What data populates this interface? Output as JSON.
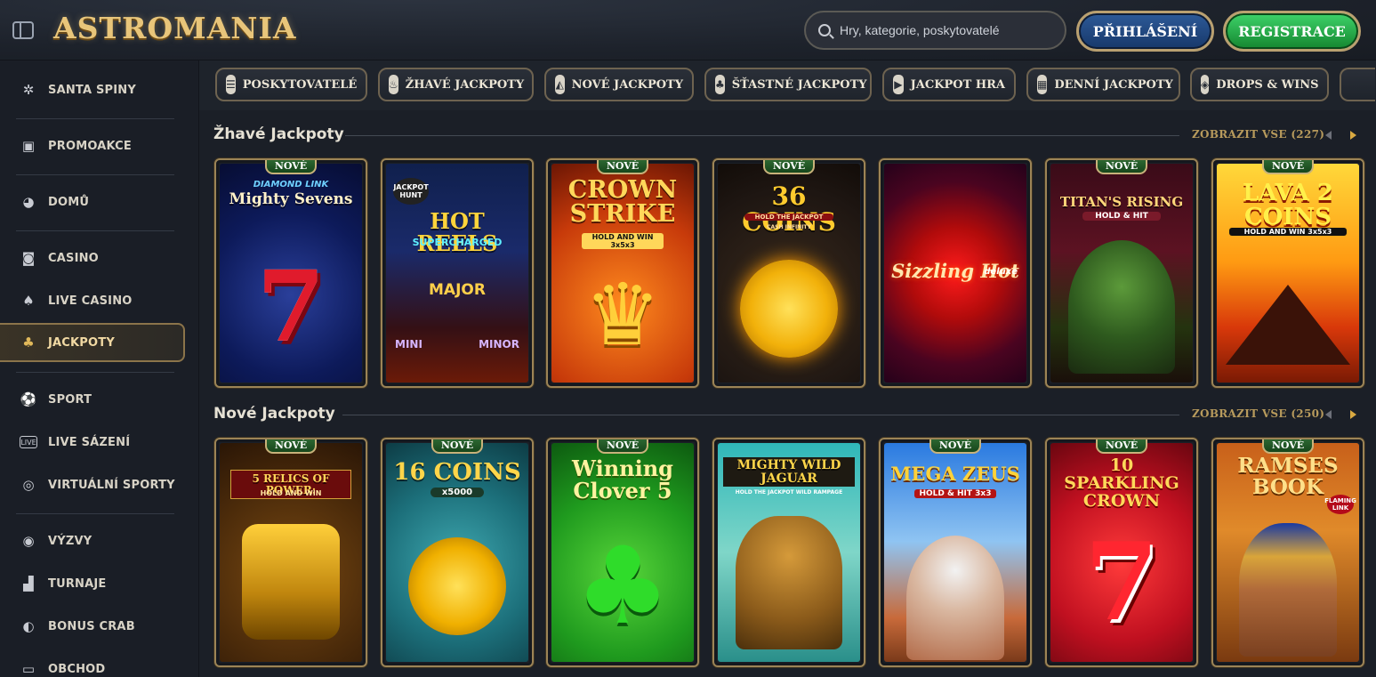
{
  "header": {
    "logo_text": "ASTROMANIA",
    "search_placeholder": "Hry, kategorie, poskytovatelé",
    "login_label": "PŘIHLÁŠENÍ",
    "register_label": "REGISTRACE",
    "icons": [
      "sidebar-toggle-icon",
      "search-icon"
    ]
  },
  "sidebar": {
    "items": [
      {
        "label": "SANTA SPINY",
        "icon": "santa-icon"
      },
      {
        "label": "PROMOAKCE",
        "icon": "gift-icon"
      },
      {
        "label": "DOMŮ",
        "icon": "home-icon"
      },
      {
        "label": "CASINO",
        "icon": "slot-machine-icon"
      },
      {
        "label": "LIVE CASINO",
        "icon": "cards-icon"
      },
      {
        "label": "JACKPOTY",
        "icon": "clover-icon",
        "active": true
      },
      {
        "label": "SPORT",
        "icon": "football-icon"
      },
      {
        "label": "LIVE SÁZENÍ",
        "icon": "live-icon"
      },
      {
        "label": "VIRTUÁLNÍ SPORTY",
        "icon": "virtual-sports-icon"
      },
      {
        "label": "VÝZVY",
        "icon": "target-icon"
      },
      {
        "label": "TURNAJE",
        "icon": "podium-icon"
      },
      {
        "label": "BONUS CRAB",
        "icon": "claw-icon"
      },
      {
        "label": "OBCHOD",
        "icon": "shop-icon"
      }
    ]
  },
  "categories": [
    {
      "label": "POSKYTOVATELÉ",
      "icon": "providers-icon"
    },
    {
      "label": "ŽHAVÉ JACKPOTY",
      "icon": "fire-icon"
    },
    {
      "label": "NOVÉ JACKPOTY",
      "icon": "bell-icon"
    },
    {
      "label": "ŠŤASTNÉ JACKPOTY",
      "icon": "clover-icon"
    },
    {
      "label": "JACKPOT HRA",
      "icon": "play-icon"
    },
    {
      "label": "DENNÍ JACKPOTY",
      "icon": "calendar-icon"
    },
    {
      "label": "DROPS & WINS",
      "icon": "drops-wins-icon"
    }
  ],
  "sections": [
    {
      "title": "Žhavé Jackpoty",
      "view_all": "ZOBRAZIT VSE (227)",
      "games": [
        {
          "name": "Mighty Sevens",
          "top": "DIAMOND LINK",
          "new": true,
          "badge": "NOVÉ"
        },
        {
          "name": "HOT REELS",
          "top": "JACKPOT HUNT",
          "sub": "SUPERCHARGED",
          "labels": [
            "MAJOR",
            "MINI",
            "MINOR"
          ],
          "new": false
        },
        {
          "name": "CROWN STRIKE",
          "sub": "HOLD AND WIN 3x5x3",
          "new": true,
          "badge": "NOVÉ"
        },
        {
          "name": "36 COINS",
          "sub": "HOLD THE JACKPOT",
          "sub2": "CASH INFINITY",
          "new": true,
          "badge": "NOVÉ"
        },
        {
          "name": "Sizzling Hot",
          "sub": "deluxe",
          "new": false
        },
        {
          "name": "TITAN'S RISING",
          "sub": "HOLD & HIT",
          "new": true,
          "badge": "NOVÉ"
        },
        {
          "name": "LAVA 2 COINS",
          "sub": "HOLD AND WIN 3x5x3",
          "new": true,
          "badge": "NOVÉ"
        }
      ]
    },
    {
      "title": "Nové Jackpoty",
      "view_all": "ZOBRAZIT VSE (250)",
      "games": [
        {
          "name": "5 RELICS OF POWER:",
          "sub": "HOLD AND WIN",
          "new": true,
          "badge": "NOVÉ"
        },
        {
          "name": "16 COINS",
          "sub": "x5000",
          "new": true,
          "badge": "NOVÉ"
        },
        {
          "name": "Winning Clover 5",
          "new": true,
          "badge": "NOVÉ"
        },
        {
          "name": "MIGHTY WILD JAGUAR",
          "sub": "HOLD THE JACKPOT WILD RAMPAGE",
          "new": false
        },
        {
          "name": "MEGA ZEUS",
          "sub": "HOLD & HIT 3x3",
          "new": true,
          "badge": "NOVÉ"
        },
        {
          "name": "10 SPARKLING CROWN",
          "new": true,
          "badge": "NOVÉ"
        },
        {
          "name": "RAMSES BOOK",
          "sub": "FLAMING LINK",
          "new": true,
          "badge": "NOVÉ"
        }
      ]
    }
  ],
  "colors": {
    "accent_gold": "#b79a5c",
    "login_blue": "#2d5a98",
    "register_green": "#2bb24f",
    "background": "#1b1f27"
  }
}
